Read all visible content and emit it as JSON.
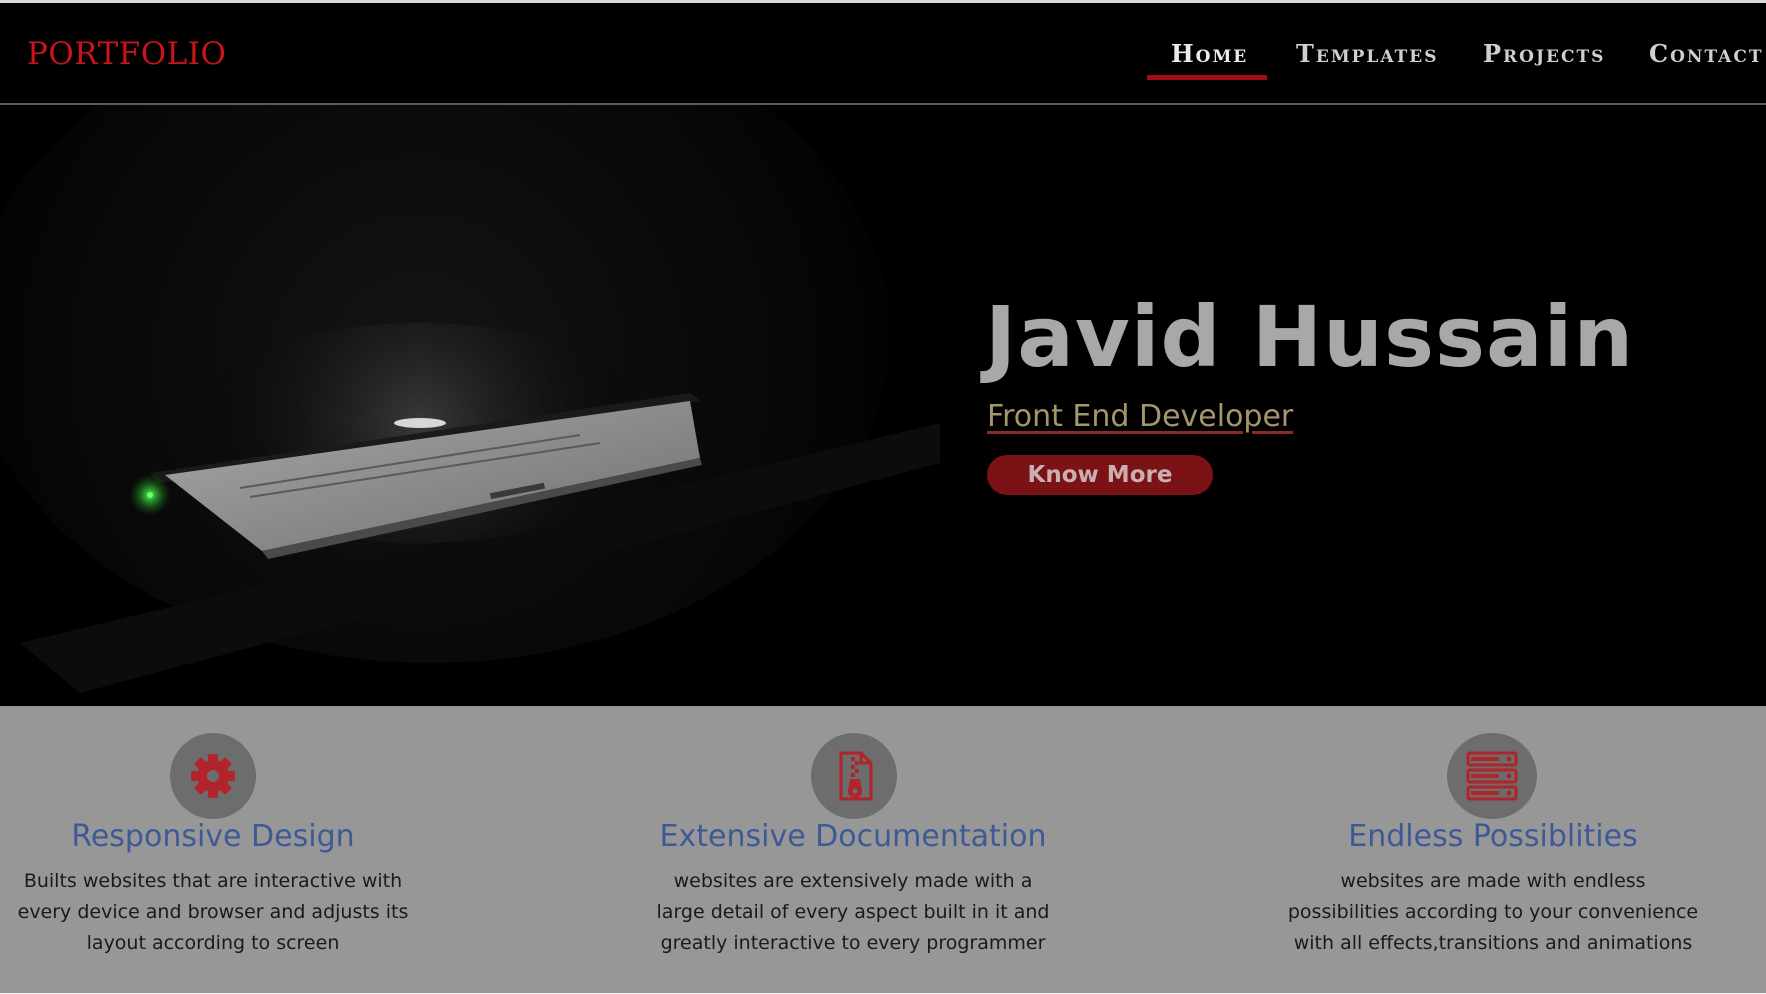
{
  "header": {
    "brand": "PORTFOLIO",
    "nav": [
      {
        "label": "Home",
        "active": true
      },
      {
        "label": "Templates",
        "active": false
      },
      {
        "label": "Projects",
        "active": false
      },
      {
        "label": "Contact",
        "active": false
      }
    ]
  },
  "hero": {
    "name": "Javid Hussain",
    "role": "Front End Developer",
    "button": "Know More"
  },
  "features": [
    {
      "icon": "gear-icon",
      "title": "Responsive Design",
      "text": "Builts websites that are interactive with every device and browser and adjusts its layout according to screen"
    },
    {
      "icon": "zip-file-icon",
      "title": "Extensive Documentation",
      "text": "websites are extensively made with a large detail of every aspect built in it and greatly interactive to every programmer"
    },
    {
      "icon": "server-icon",
      "title": "Endless Possiblities",
      "text": "websites are made with endless possibilities according to your convenience with all effects,transitions and animations"
    }
  ],
  "colors": {
    "accent": "#c8151b",
    "feature_title": "#3e5a96",
    "features_bg": "#979797"
  }
}
